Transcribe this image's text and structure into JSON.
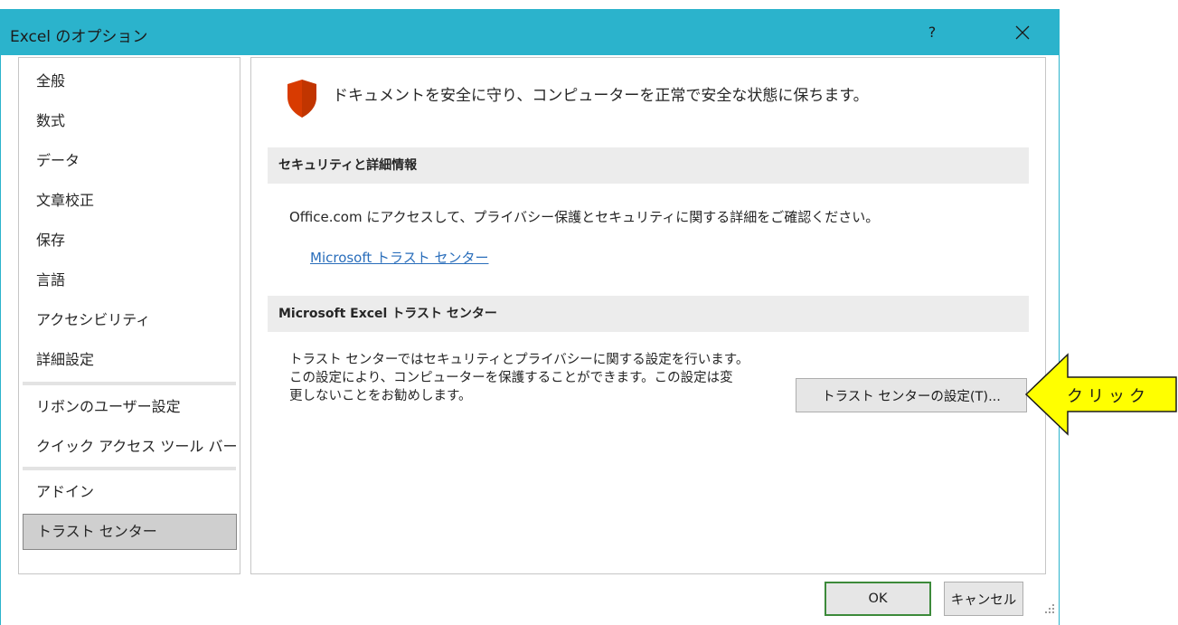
{
  "window": {
    "title": "Excel のオプション",
    "help_label": "?",
    "accent_color": "#2bb3cc"
  },
  "sidebar": {
    "items": [
      {
        "label": "全般"
      },
      {
        "label": "数式"
      },
      {
        "label": "データ"
      },
      {
        "label": "文章校正"
      },
      {
        "label": "保存"
      },
      {
        "label": "言語"
      },
      {
        "label": "アクセシビリティ"
      },
      {
        "label": "詳細設定"
      },
      {
        "label": "リボンのユーザー設定"
      },
      {
        "label": "クイック アクセス ツール バー"
      },
      {
        "label": "アドイン"
      },
      {
        "label": "トラスト センター",
        "selected": true
      }
    ]
  },
  "main": {
    "headline": "ドキュメントを安全に守り、コンピューターを正常で安全な状態に保ちます。",
    "headline_icon": "shield-icon",
    "security_section": {
      "header": "セキュリティと詳細情報",
      "text": "Office.com にアクセスして、プライバシー保護とセキュリティに関する詳細をご確認ください。",
      "link": "Microsoft トラスト センター"
    },
    "trust_section": {
      "header": "Microsoft Excel トラスト センター",
      "description_lines": [
        "トラスト センターではセキュリティとプライバシーに関する設定を行います。",
        "この設定により、コンピューターを保護することができます。この設定は変",
        "更しないことをお勧めします。"
      ],
      "settings_button": "トラスト センターの設定(T)..."
    }
  },
  "footer": {
    "ok_label": "OK",
    "cancel_label": "キャンセル"
  },
  "annotation": {
    "label": "クリック",
    "arrow_color": "#ffff00"
  }
}
